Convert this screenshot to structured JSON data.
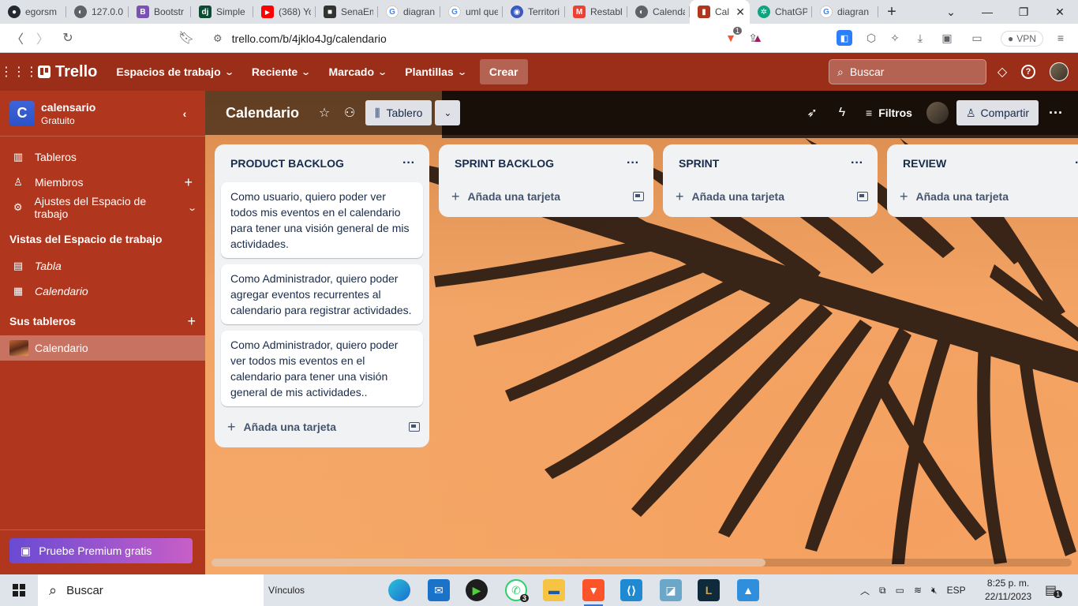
{
  "browser": {
    "tabs": [
      {
        "label": "egorsm",
        "icon": "github-icon",
        "color": "#24292f"
      },
      {
        "label": "127.0.0.",
        "icon": "globe-icon",
        "color": "#5f6368"
      },
      {
        "label": "Bootstr",
        "icon": "bootstrap-icon",
        "color": "#7952b3"
      },
      {
        "label": "Simple",
        "icon": "django-icon",
        "color": "#0c4b33"
      },
      {
        "label": "(368) Yo",
        "icon": "youtube-icon",
        "color": "#ff0000"
      },
      {
        "label": "SenaEm",
        "icon": "sena-icon",
        "color": "#333333"
      },
      {
        "label": "diagran",
        "icon": "google-icon",
        "color": "#4285f4"
      },
      {
        "label": "uml que",
        "icon": "google-icon",
        "color": "#4285f4"
      },
      {
        "label": "Territori",
        "icon": "eye-icon",
        "color": "#3a57c4"
      },
      {
        "label": "Restabl",
        "icon": "gmail-icon",
        "color": "#ea4335"
      },
      {
        "label": "Calenda",
        "icon": "globe-icon",
        "color": "#5f6368"
      },
      {
        "label": "Cal",
        "icon": "trello-icon",
        "color": "#b0361e",
        "active": true
      },
      {
        "label": "ChatGP",
        "icon": "chatgpt-icon",
        "color": "#10a37f"
      },
      {
        "label": "diagran",
        "icon": "google-icon",
        "color": "#4285f4"
      }
    ],
    "url": "trello.com/b/4jklo4Jg/calendario",
    "vpn_label": "VPN",
    "brave_badge": "1"
  },
  "header": {
    "logo": "Trello",
    "menus": [
      "Espacios de trabajo",
      "Reciente",
      "Marcado",
      "Plantillas"
    ],
    "create_label": "Crear",
    "search_placeholder": "Buscar"
  },
  "sidebar": {
    "workspace_initial": "C",
    "workspace_name": "calensario",
    "workspace_plan": "Gratuito",
    "items": [
      {
        "label": "Tableros",
        "icon": "board-icon"
      },
      {
        "label": "Miembros",
        "icon": "person-icon"
      },
      {
        "label": "Ajustes del Espacio de trabajo",
        "icon": "gear-icon"
      }
    ],
    "views_title": "Vistas del Espacio de trabajo",
    "views": [
      {
        "label": "Tabla",
        "icon": "table-icon"
      },
      {
        "label": "Calendario",
        "icon": "calendar-icon"
      }
    ],
    "boards_title": "Sus tableros",
    "boards": [
      {
        "label": "Calendario"
      }
    ],
    "premium_label": "Pruebe Premium gratis"
  },
  "board": {
    "title": "Calendario",
    "view_label": "Tablero",
    "filters_label": "Filtros",
    "share_label": "Compartir",
    "lists": [
      {
        "title": "PRODUCT BACKLOG",
        "cards": [
          "Como usuario, quiero poder ver todos mis eventos en el calendario para tener una visión general de mis actividades.",
          "Como Administrador, quiero poder agregar eventos recurrentes al calendario para registrar actividades.",
          "Como Administrador, quiero poder ver todos mis eventos en el calendario para tener una visión general de mis actividades.."
        ],
        "add_label": "Añada una tarjeta"
      },
      {
        "title": "SPRINT BACKLOG",
        "cards": [],
        "add_label": "Añada una tarjeta"
      },
      {
        "title": "SPRINT",
        "cards": [],
        "add_label": "Añada una tarjeta"
      },
      {
        "title": "REVIEW",
        "cards": [],
        "add_label": "Añada una tarjeta"
      }
    ]
  },
  "taskbar": {
    "search_label": "Buscar",
    "links_label": "Vínculos",
    "whatsapp_badge": "3",
    "language": "ESP",
    "time": "8:25 p. m.",
    "date": "22/11/2023",
    "notif_count": "1"
  }
}
